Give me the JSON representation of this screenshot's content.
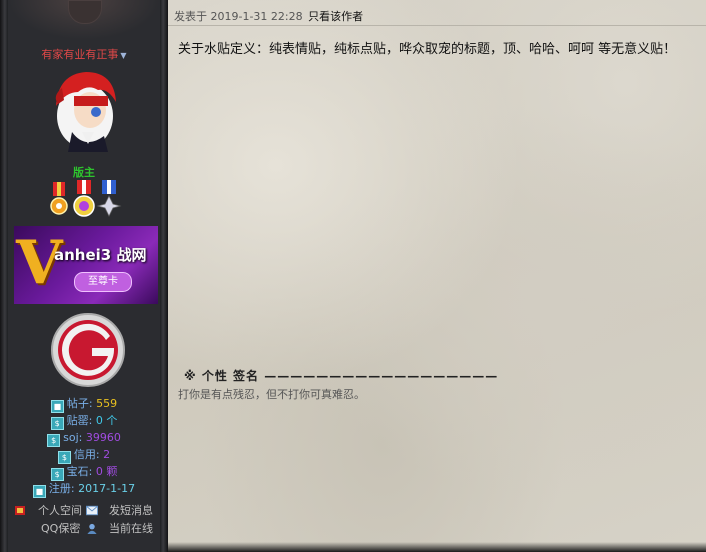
{
  "user": {
    "name": "有家有业有正事",
    "role": "版主",
    "banner_title": "anhei3 战网",
    "banner_badge": "至尊卡",
    "banner_letter": "V"
  },
  "stats": [
    {
      "label": "帖子:",
      "value": "559"
    },
    {
      "label": "贴罂:",
      "value": "0 个"
    },
    {
      "label": "soj:",
      "value": "39960"
    },
    {
      "label": "信用:",
      "value": "2"
    },
    {
      "label": "宝石:",
      "value": "0 颗"
    },
    {
      "label": "注册:",
      "value": "2017-1-17"
    }
  ],
  "links": {
    "space": "个人空间",
    "message": "发短消息",
    "qq": "QQ保密",
    "online": "当前在线"
  },
  "post": {
    "meta": "发表于 2019-1-31 22:28",
    "only_author": "只看该作者",
    "body": "关于水贴定义：纯表情贴，纯标点贴，哗众取宠的标题，顶、哈哈、呵呵 等无意义贴！",
    "sig_title": "※ 个性 签名 ——————————————————",
    "sig_text": "打你是有点残忍，但不打你可真难忍。"
  },
  "colors": {
    "username": "#e04848",
    "role": "#2ec42e",
    "stat_label": "#7ab0e8"
  }
}
